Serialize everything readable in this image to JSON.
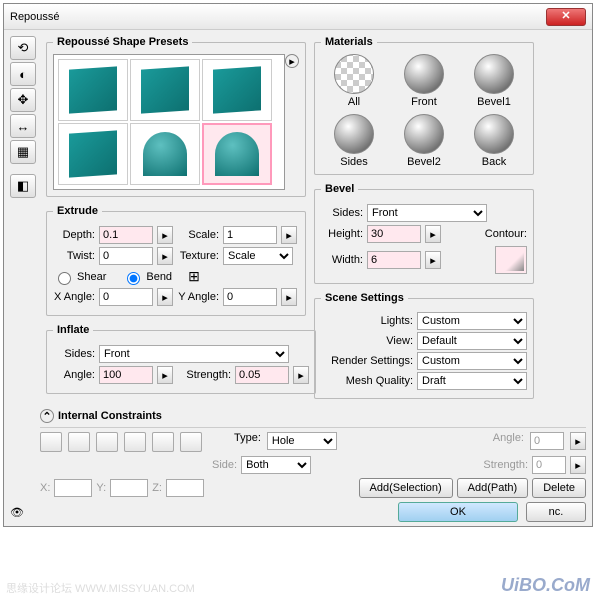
{
  "title": "Repoussé",
  "presets": {
    "legend": "Repoussé Shape Presets",
    "selected_index": 5
  },
  "materials": {
    "legend": "Materials",
    "items": [
      "All",
      "Front",
      "Bevel1",
      "Sides",
      "Bevel2",
      "Back"
    ]
  },
  "extrude": {
    "legend": "Extrude",
    "depth_label": "Depth:",
    "depth": "0.1",
    "scale_label": "Scale:",
    "scale": "1",
    "twist_label": "Twist:",
    "twist": "0",
    "texture_label": "Texture:",
    "texture": "Scale",
    "shear_label": "Shear",
    "bend_label": "Bend",
    "bend_selected": true,
    "xangle_label": "X Angle:",
    "xangle": "0",
    "yangle_label": "Y Angle:",
    "yangle": "0"
  },
  "inflate": {
    "legend": "Inflate",
    "sides_label": "Sides:",
    "sides": "Front",
    "angle_label": "Angle:",
    "angle": "100",
    "strength_label": "Strength:",
    "strength": "0.05"
  },
  "bevel": {
    "legend": "Bevel",
    "sides_label": "Sides:",
    "sides": "Front",
    "height_label": "Height:",
    "height": "30",
    "width_label": "Width:",
    "width": "6",
    "contour_label": "Contour:"
  },
  "scene": {
    "legend": "Scene Settings",
    "lights_label": "Lights:",
    "lights": "Custom",
    "view_label": "View:",
    "view": "Default",
    "render_label": "Render Settings:",
    "render": "Custom",
    "mesh_label": "Mesh Quality:",
    "mesh": "Draft"
  },
  "constraints": {
    "legend": "Internal Constraints",
    "type_label": "Type:",
    "type": "Hole",
    "side_label": "Side:",
    "side": "Both",
    "x_label": "X:",
    "y_label": "Y:",
    "z_label": "Z:",
    "angle_label": "Angle:",
    "angle": "0",
    "strength_label": "Strength:",
    "strength": "0",
    "add_sel": "Add(Selection)",
    "add_path": "Add(Path)",
    "delete": "Delete"
  },
  "buttons": {
    "ok": "OK",
    "cancel": "nc."
  },
  "watermark": {
    "left": "思缘设计论坛  WWW.MISSYUAN.COM",
    "right": "UiBO.CoM"
  }
}
